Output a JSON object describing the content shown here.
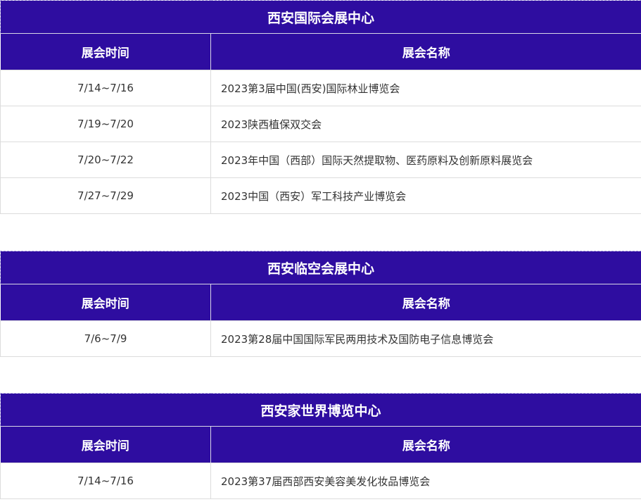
{
  "sections": [
    {
      "title": "西安国际会展中心",
      "header_date": "展会时间",
      "header_name": "展会名称",
      "rows": [
        {
          "date": "7/14~7/16",
          "name": "2023第3届中国(西安)国际林业博览会"
        },
        {
          "date": "7/19~7/20",
          "name": "2023陕西植保双交会"
        },
        {
          "date": "7/20~7/22",
          "name": "2023年中国（西部）国际天然提取物、医药原料及创新原料展览会"
        },
        {
          "date": "7/27~7/29",
          "name": "2023中国（西安）军工科技产业博览会"
        }
      ]
    },
    {
      "title": "西安临空会展中心",
      "header_date": "展会时间",
      "header_name": "展会名称",
      "rows": [
        {
          "date": "7/6~7/9",
          "name": "2023第28届中国国际军民两用技术及国防电子信息博览会"
        }
      ]
    },
    {
      "title": "西安家世界博览中心",
      "header_date": "展会时间",
      "header_name": "展会名称",
      "rows": [
        {
          "date": "7/14~7/16",
          "name": "2023第37届西部西安美容美发化妆品博览会"
        }
      ]
    }
  ],
  "colors": {
    "header_bg": "#2e0da0",
    "header_text": "#ffffff",
    "body_text": "#333333"
  }
}
